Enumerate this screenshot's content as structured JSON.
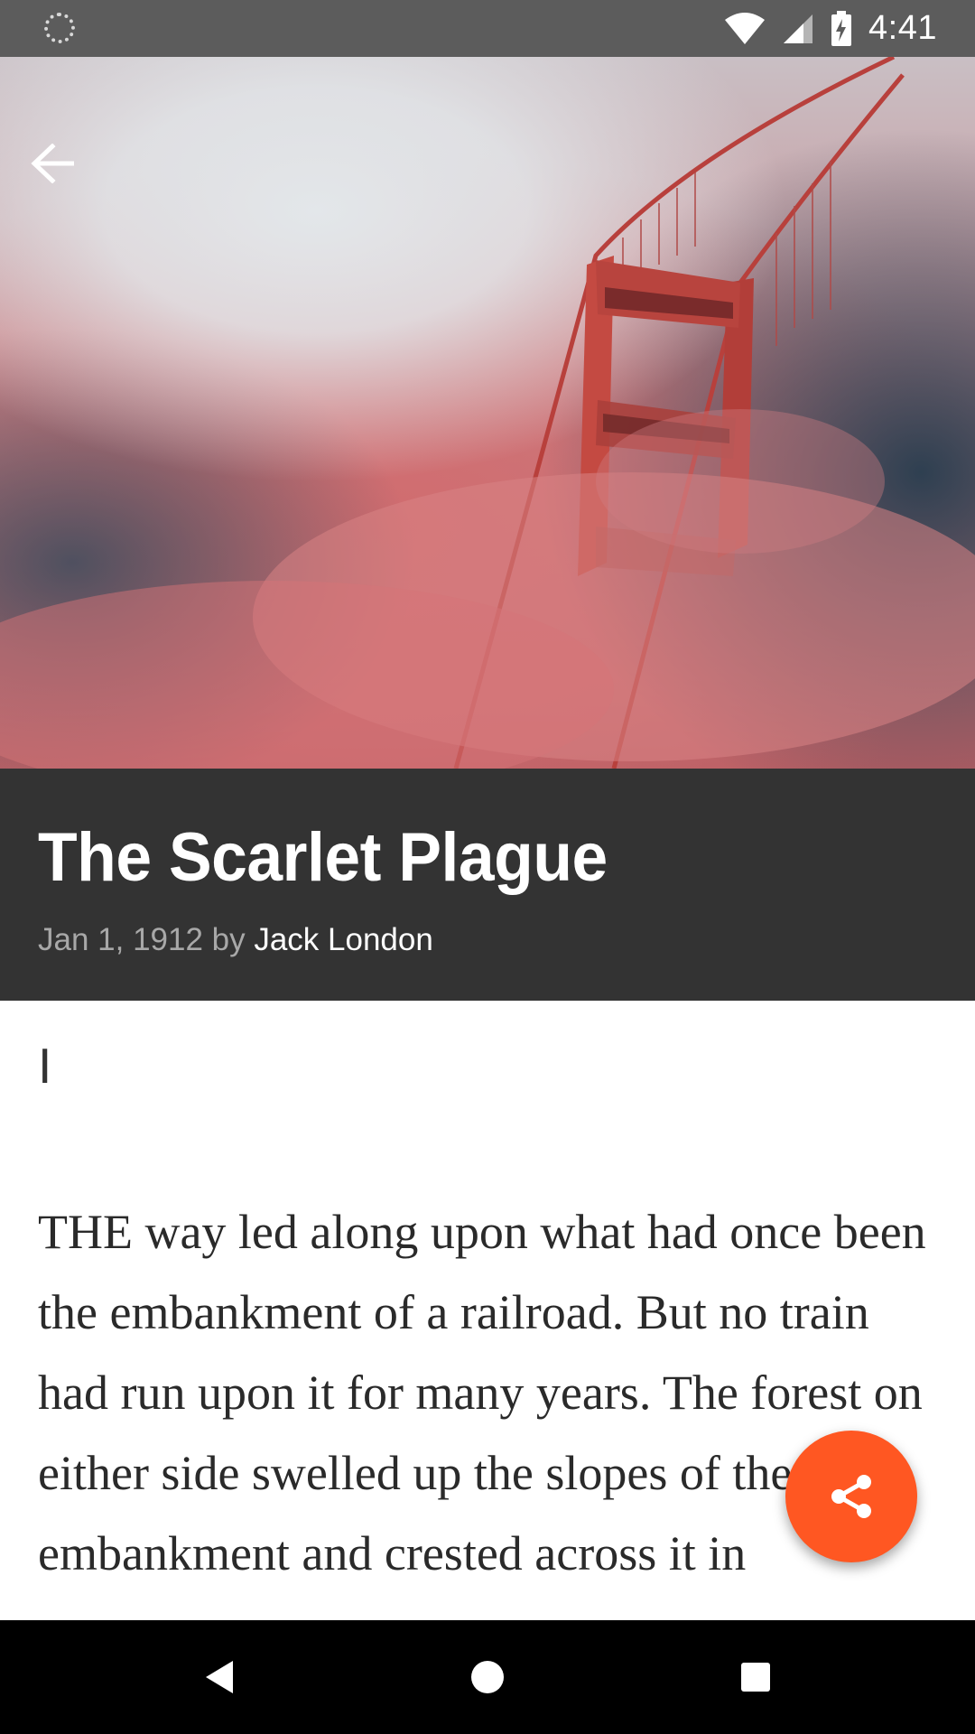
{
  "status_bar": {
    "time": "4:41",
    "icons": [
      "loading-icon",
      "wifi-icon",
      "signal-icon",
      "battery-charging-icon"
    ]
  },
  "toolbar": {
    "back_icon": "arrow-back-icon"
  },
  "hero": {
    "image": "golden-gate-bridge-in-fog"
  },
  "article": {
    "title": "The Scarlet Plague",
    "date_by": "Jan 1, 1912 by ",
    "author": "Jack London",
    "chapter": "I",
    "paragraph": "THE way led along upon what had once been the embankment of a railroad. But no train had run upon it for many years. The forest on either side swelled up the slopes of the embankment and crested across it in"
  },
  "fab": {
    "icon": "share-icon",
    "color": "#ff5722"
  },
  "nav_bar": {
    "icons": [
      "back-triangle-icon",
      "home-circle-icon",
      "recents-square-icon"
    ]
  },
  "colors": {
    "status_bar": "#5c5c5c",
    "title_block": "#333333",
    "accent": "#ff5722"
  }
}
